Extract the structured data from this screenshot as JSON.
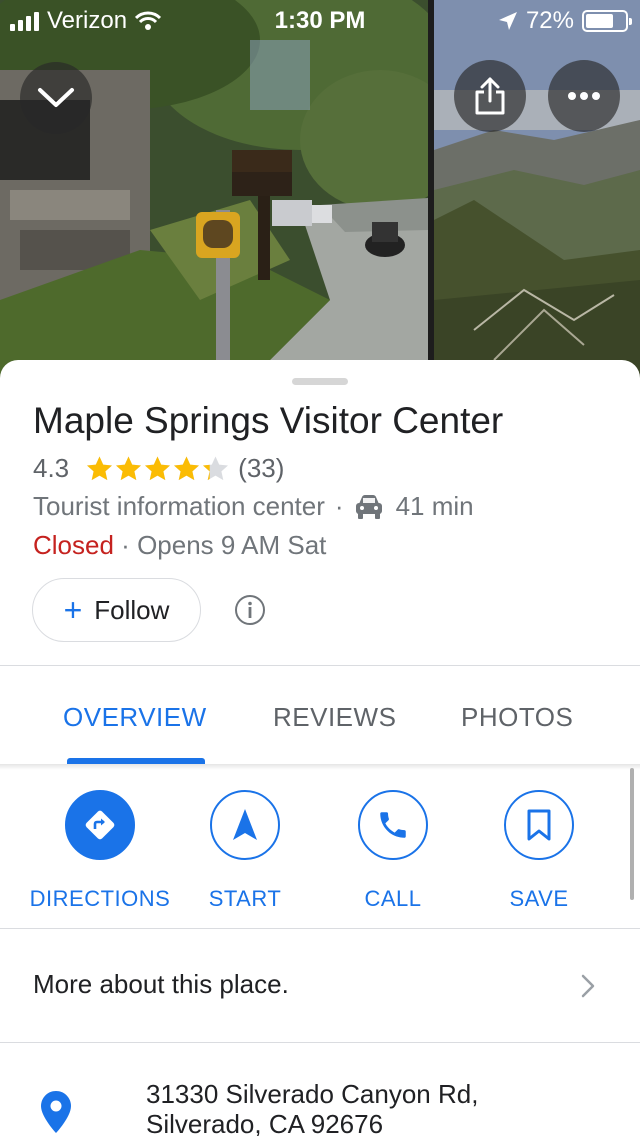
{
  "status_bar": {
    "carrier": "Verizon",
    "time": "1:30 PM",
    "battery_text": "72%",
    "battery_level": 0.72
  },
  "header": {
    "back_icon": "chevron-down-icon",
    "share_icon": "share-icon",
    "more_icon": "more-horizontal-icon"
  },
  "place": {
    "title": "Maple Springs Visitor Center",
    "rating": "4.3",
    "rating_value": 4.3,
    "rating_max": 5,
    "review_count": "(33)",
    "category": "Tourist information center",
    "separator": "·",
    "drive_time": "41 min",
    "status": "Closed",
    "opens": "Opens 9 AM Sat",
    "follow_label": "Follow",
    "follow_plus": "+"
  },
  "tabs": [
    {
      "label": "OVERVIEW",
      "active": true
    },
    {
      "label": "REVIEWS",
      "active": false
    },
    {
      "label": "PHOTOS",
      "active": false
    }
  ],
  "actions": [
    {
      "label": "DIRECTIONS",
      "icon": "directions-icon"
    },
    {
      "label": "START",
      "icon": "navigation-arrow-icon"
    },
    {
      "label": "CALL",
      "icon": "phone-icon"
    },
    {
      "label": "SAVE",
      "icon": "bookmark-icon"
    }
  ],
  "more": {
    "label": "More about this place."
  },
  "address": {
    "line1": "31330 Silverado Canyon Rd,",
    "line2": "Silverado, CA 92676"
  },
  "colors": {
    "accent": "#1a73e8",
    "closed": "#c5221f",
    "star": "#fbbc04",
    "text_primary": "#202124",
    "text_secondary": "#70757a"
  }
}
